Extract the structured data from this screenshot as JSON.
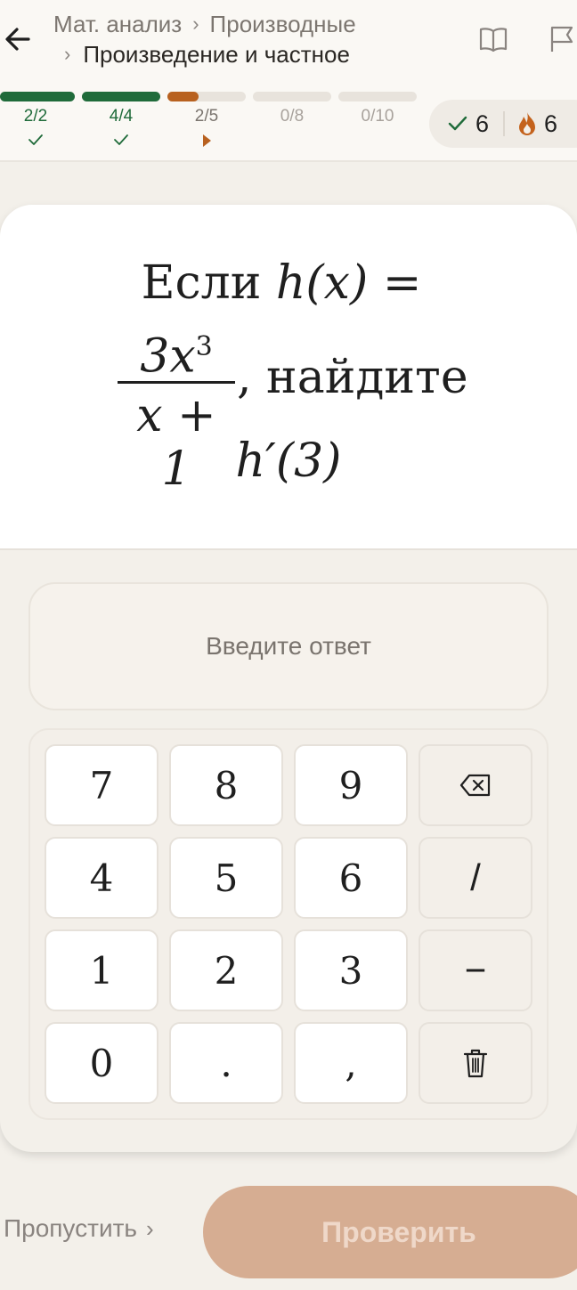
{
  "breadcrumb": {
    "parent": "Мат. анализ",
    "section": "Производные",
    "current": "Произведение и частное"
  },
  "progress": [
    {
      "label": "2/2",
      "done": 2,
      "total": 2,
      "state": "complete"
    },
    {
      "label": "4/4",
      "done": 4,
      "total": 4,
      "state": "complete"
    },
    {
      "label": "2/5",
      "done": 2,
      "total": 5,
      "state": "current"
    },
    {
      "label": "0/8",
      "done": 0,
      "total": 8,
      "state": "pending"
    },
    {
      "label": "0/10",
      "done": 0,
      "total": 10,
      "state": "pending"
    }
  ],
  "stats": {
    "correct": "6",
    "streak": "6"
  },
  "question": {
    "prefix": "Если",
    "function": "h(x) =",
    "numerator": "3x",
    "exponent": "3",
    "denominator": "x + 1",
    "suffix": ", найдите",
    "target": "h′(3)"
  },
  "answer": {
    "placeholder": "Введите ответ"
  },
  "keypad": [
    [
      "7",
      "8",
      "9",
      "backspace-icon"
    ],
    [
      "4",
      "5",
      "6",
      "/"
    ],
    [
      "1",
      "2",
      "3",
      "−"
    ],
    [
      "0",
      ".",
      ",",
      "trash-icon"
    ]
  ],
  "footer": {
    "skip_label": "Пропустить",
    "check_label": "Проверить"
  },
  "colors": {
    "complete": "#1f6b3a",
    "current": "#b8611f",
    "accent": "#d6ad92"
  }
}
